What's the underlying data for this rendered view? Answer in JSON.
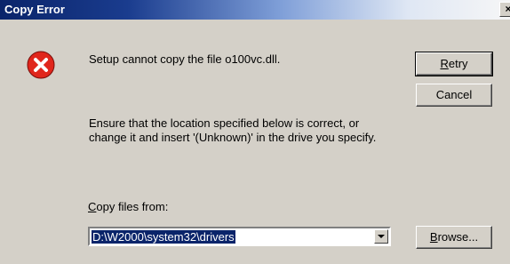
{
  "window": {
    "title": "Copy Error",
    "close_label": "×"
  },
  "message": {
    "primary": "Setup cannot copy the file o100vc.dll.",
    "instruction": "Ensure that the location specified below is correct, or change it and insert '(Unknown)' in the drive you specify."
  },
  "buttons": {
    "retry_prefix": "",
    "retry_mnemonic": "R",
    "retry_rest": "etry",
    "cancel": "Cancel",
    "browse_prefix": "",
    "browse_mnemonic": "B",
    "browse_rest": "rowse..."
  },
  "copy_from": {
    "label_mnemonic": "C",
    "label_rest": "opy files from:",
    "value": "D:\\W2000\\system32\\drivers"
  },
  "colors": {
    "title_bar": "#0a246a",
    "face": "#d4d0c8",
    "error_icon": "#e0261c"
  },
  "icons": {
    "error": "error-icon",
    "dropdown": "chevron-down-icon"
  }
}
